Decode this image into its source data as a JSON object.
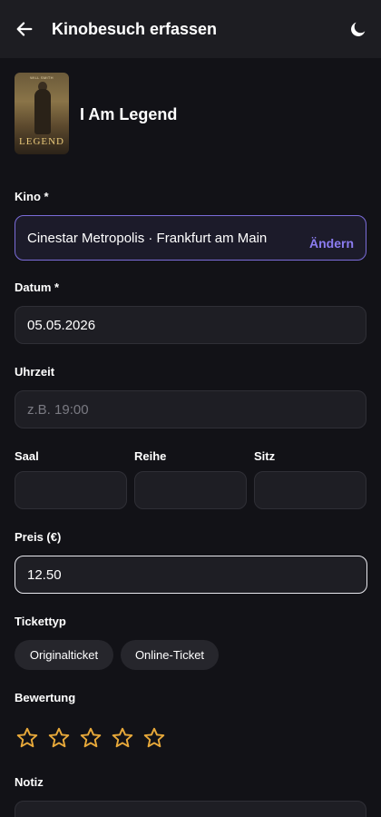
{
  "header": {
    "title": "Kinobesuch erfassen",
    "back_icon": "arrow-left-icon",
    "theme_icon": "moon-icon"
  },
  "movie": {
    "title": "I Am Legend",
    "poster_top_text": "WILL SMITH",
    "poster_title": "LEGEND"
  },
  "form": {
    "kino": {
      "label": "Kino *",
      "value": "Cinestar Metropolis · Frankfurt am Main",
      "change_label": "Ändern"
    },
    "datum": {
      "label": "Datum *",
      "value": "05.05.2026"
    },
    "uhrzeit": {
      "label": "Uhrzeit",
      "value": "",
      "placeholder": "z.B. 19:00"
    },
    "saal": {
      "label": "Saal",
      "value": ""
    },
    "reihe": {
      "label": "Reihe",
      "value": ""
    },
    "sitz": {
      "label": "Sitz",
      "value": ""
    },
    "preis": {
      "label": "Preis (€)",
      "value": "12.50"
    },
    "tickettyp": {
      "label": "Tickettyp",
      "options": [
        "Originalticket",
        "Online-Ticket"
      ]
    },
    "bewertung": {
      "label": "Bewertung",
      "max_stars": 5,
      "value": 0,
      "star_color": "#e8a93a"
    },
    "notiz": {
      "label": "Notiz",
      "value": ""
    }
  },
  "colors": {
    "background": "#121217",
    "accent": "#8b7cf0"
  }
}
